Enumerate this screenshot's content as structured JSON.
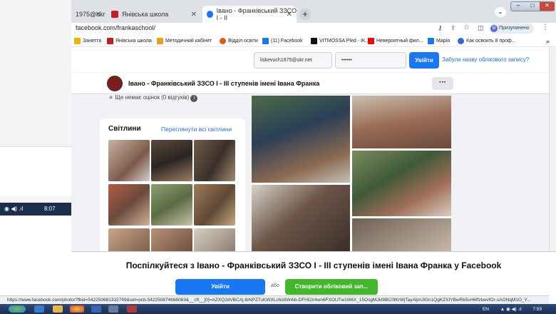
{
  "background_window": {
    "tab_text": "1975@ukr",
    "clock": "8:07"
  },
  "tabs": [
    {
      "label": "Янівська школа",
      "color": "#c0201f"
    },
    {
      "label": "Івано - Франківський ЗЗСО І - ІІ",
      "color": "#1877f2"
    }
  ],
  "address": {
    "url": "facebook.com/frankaschool/"
  },
  "profile_button": "Призупинено",
  "bookmarks": [
    {
      "label": "Заняття",
      "color": "#f0b400"
    },
    {
      "label": "Янівська школа",
      "color": "#c0201f"
    },
    {
      "label": "Методичний кабінет",
      "color": "#e6a317"
    },
    {
      "label": "Відділ освіти",
      "color": "#e05a1b"
    },
    {
      "label": "(11) Facebook",
      "color": "#1877f2"
    },
    {
      "label": "VITMOSSA Pled - IK...",
      "color": "#111111"
    },
    {
      "label": "Невероятный фил...",
      "color": "#ff0000"
    },
    {
      "label": "Марія",
      "color": "#1877f2"
    },
    {
      "label": "Как освоить 8 проф...",
      "color": "#3367d6"
    }
  ],
  "login": {
    "email_value": "liskevuch1975@ukr.net",
    "password_value": "••••••",
    "login_label": "Увійти",
    "forgot_label": "Забули назву облікового запису?"
  },
  "page": {
    "name": "Івано - Франківський ЗЗСО І - ІІІ ступенів імені Івана Франка",
    "more_label": "···",
    "rating_text": "Ще немає оцінок (0 відгуків)",
    "photos_title": "Світлини",
    "photos_link": "Переглянути всі світлини"
  },
  "cta": {
    "title": "Поспілкуйтеся з Івано - Франківський ЗЗСО І - ІІІ ступенів імені Івана Франка у Facebook",
    "login_label": "Увійти",
    "or_label": "або",
    "create_label": "Створити обліковий зап..."
  },
  "status_url": "https://www.facebook.com/photo/?fbid=542250681332749&set=pcb.542250874666063&__cft__[0]=AZXQ2dVBCAj-lbNPZ7uKWXLcho9W4ib-DFHDX4wn6FXOIJTw1t66X_15OsgMJkt9BC0lKrWjTayAljmJlGn1QgKZXIYBwRk5sH6ffzkwvfOr-sAONqM1O_Y...",
  "taskbar": {
    "lang": "EN",
    "clock": "7:59"
  }
}
